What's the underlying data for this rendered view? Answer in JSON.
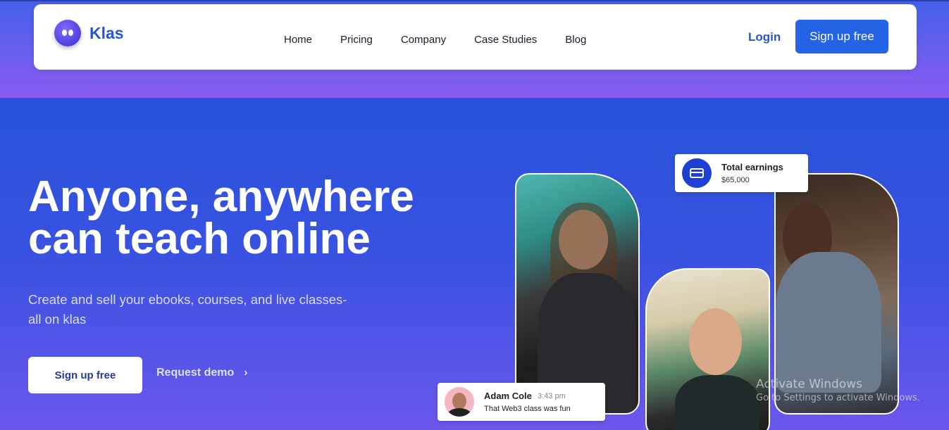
{
  "brand": {
    "name": "Klas",
    "logo_icon": "klas-logo-icon"
  },
  "nav": {
    "links": [
      "Home",
      "Pricing",
      "Company",
      "Case Studies",
      "Blog"
    ],
    "login_label": "Login",
    "signup_label": "Sign up free"
  },
  "hero": {
    "headline_line1": "Anyone, anywhere",
    "headline_line2": "can teach online",
    "subtext_line1": "Create and sell your ebooks, courses, and live classes-",
    "subtext_line2": "all on klas",
    "primary_cta": "Sign up free",
    "secondary_cta": "Request demo",
    "secondary_cta_icon": "chevron-right-icon"
  },
  "cards": {
    "earnings": {
      "title": "Total earnings",
      "value": "$65,000",
      "icon": "credit-card-icon"
    },
    "chat": {
      "name": "Adam Cole",
      "time": "3:43 pm",
      "message": "That Web3 class was fun"
    }
  },
  "watermark": {
    "title": "Activate Windows",
    "subtitle": "Go to Settings to activate Windows."
  },
  "colors": {
    "brand_blue": "#2456d6",
    "button_blue": "#2563e6",
    "hero_top": "#2753da",
    "hero_bottom": "#6b57ec"
  }
}
